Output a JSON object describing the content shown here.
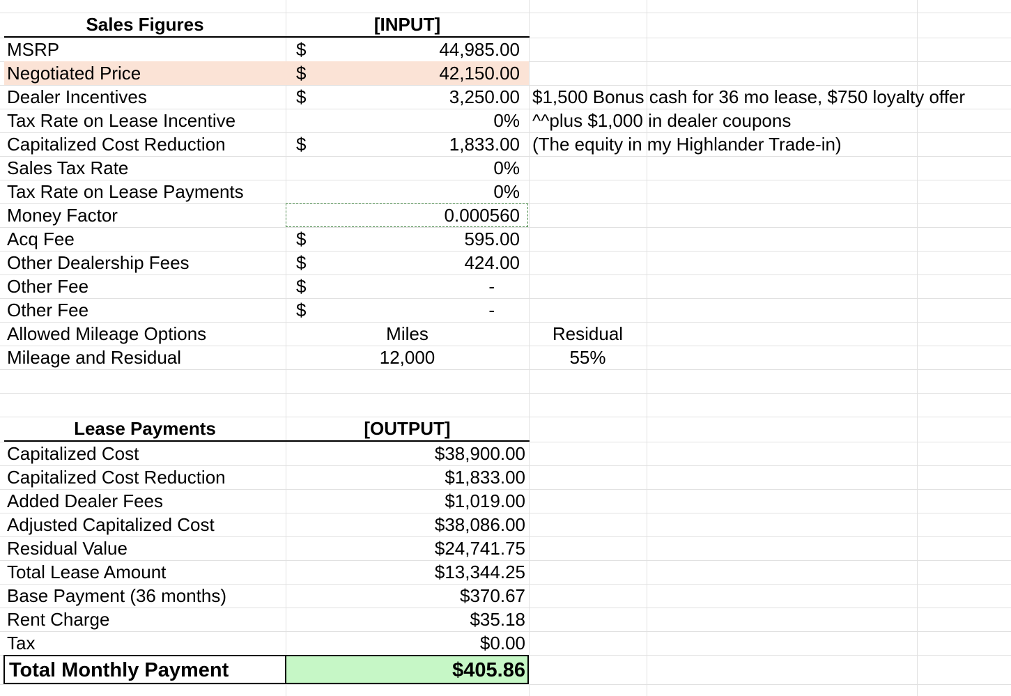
{
  "sales": {
    "header": "Sales Figures",
    "input_header": "[INPUT]",
    "rows": [
      {
        "label": "MSRP",
        "currency": "$",
        "value": "44,985.00",
        "note": ""
      },
      {
        "label": "Negotiated Price",
        "currency": "$",
        "value": "42,150.00",
        "note": ""
      },
      {
        "label": "Dealer Incentives",
        "currency": "$",
        "value": "3,250.00",
        "note": "$1,500 Bonus cash for 36 mo lease, $750 loyalty offer"
      },
      {
        "label": "Tax Rate on Lease Incentive",
        "currency": "",
        "value": "0%",
        "note": "^^plus $1,000 in dealer coupons"
      },
      {
        "label": "Capitalized Cost Reduction",
        "currency": "$",
        "value": "1,833.00",
        "note": "(The equity in my Highlander Trade-in)"
      },
      {
        "label": "Sales Tax Rate",
        "currency": "",
        "value": "0%",
        "note": ""
      },
      {
        "label": "Tax Rate on Lease Payments",
        "currency": "",
        "value": "0%",
        "note": ""
      },
      {
        "label": "Money Factor",
        "currency": "",
        "value": "0.000560",
        "note": ""
      },
      {
        "label": "Acq Fee",
        "currency": "$",
        "value": "595.00",
        "note": ""
      },
      {
        "label": "Other Dealership Fees",
        "currency": "$",
        "value": "424.00",
        "note": ""
      },
      {
        "label": "Other Fee",
        "currency": "$",
        "value": "-",
        "note": ""
      },
      {
        "label": "Other Fee",
        "currency": "$",
        "value": "-",
        "note": ""
      }
    ],
    "mileage": {
      "options_label": "Allowed Mileage Options",
      "miles_header": "Miles",
      "residual_header": "Residual",
      "row_label": "Mileage and Residual",
      "miles": "12,000",
      "residual": "55%"
    }
  },
  "lease": {
    "header": "Lease Payments",
    "output_header": "[OUTPUT]",
    "rows": [
      {
        "label": "Capitalized Cost",
        "value": "$38,900.00"
      },
      {
        "label": "Capitalized Cost Reduction",
        "value": "$1,833.00"
      },
      {
        "label": "Added Dealer Fees",
        "value": "$1,019.00"
      },
      {
        "label": "Adjusted Capitalized Cost",
        "value": "$38,086.00"
      },
      {
        "label": "Residual Value",
        "value": "$24,741.75"
      },
      {
        "label": "Total Lease Amount",
        "value": "$13,344.25"
      },
      {
        "label": "Base Payment (36 months)",
        "value": "$370.67"
      },
      {
        "label": "Rent Charge",
        "value": "$35.18"
      },
      {
        "label": "Tax",
        "value": "$0.00"
      }
    ],
    "total": {
      "label": "Total Monthly Payment",
      "value": "$405.86"
    }
  },
  "colors": {
    "negotiated_highlight": "#fbe3d6",
    "total_highlight": "#c6f7c6",
    "gridline": "#e1e1e1"
  }
}
